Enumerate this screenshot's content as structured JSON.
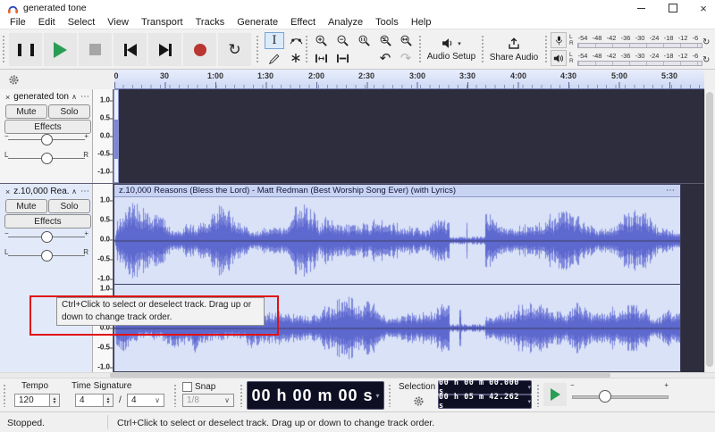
{
  "window": {
    "title": "generated tone"
  },
  "menu": {
    "items": [
      "File",
      "Edit",
      "Select",
      "View",
      "Transport",
      "Tracks",
      "Generate",
      "Effect",
      "Analyze",
      "Tools",
      "Help"
    ]
  },
  "toolbar": {
    "audio_setup": "Audio Setup",
    "share_audio": "Share Audio"
  },
  "meters": {
    "scale": [
      "-54",
      "-48",
      "-42",
      "-36",
      "-30",
      "-24",
      "-18",
      "-12",
      "-6"
    ],
    "left": "L",
    "right": "R"
  },
  "timeline": {
    "ticks": [
      "0",
      "30",
      "1:00",
      "1:30",
      "2:00",
      "2:30",
      "3:00",
      "3:30",
      "4:00",
      "4:30",
      "5:00",
      "5:30"
    ]
  },
  "icons": {
    "window_close": "×",
    "close": "×",
    "chevron_up": "∧",
    "menu_dots": "⋯",
    "caret_down": "▾",
    "select_caret": "∨",
    "undo": "↶",
    "redo": "↷",
    "loop": "↻",
    "reset": "↻",
    "multi_tool": "∗",
    "selection_tool": "I",
    "minus": "−",
    "plus": "+"
  },
  "tracks": [
    {
      "name": "generated tone",
      "mute": "Mute",
      "solo": "Solo",
      "effects": "Effects",
      "gain_min": "−",
      "gain_max": "+",
      "pan_left": "L",
      "pan_right": "R",
      "scale": [
        "1.0",
        "0.5",
        "0.0",
        "-0.5",
        "-1.0"
      ]
    },
    {
      "name": "z.10,000 Rea...",
      "mute": "Mute",
      "solo": "Solo",
      "effects": "Effects",
      "gain_min": "−",
      "gain_max": "+",
      "pan_left": "L",
      "pan_right": "R",
      "clip_title": "z.10,000 Reasons (Bless the Lord) - Matt Redman (Best Worship Song Ever) (with Lyrics)",
      "scale": [
        "1.0",
        "0.5",
        "0.0",
        "-0.5",
        "-1.0"
      ]
    }
  ],
  "tooltip": {
    "text": "Ctrl+Click to select or deselect track. Drag up or down to change track order."
  },
  "bottom": {
    "tempo_label": "Tempo",
    "tempo_value": "120",
    "time_signature_label": "Time Signature",
    "time_signature_upper": "4",
    "time_signature_divider": "/",
    "time_signature_lower": "4",
    "snap_label": "Snap",
    "snap_value": "1/8",
    "time_display": "00 h 00 m 00 s",
    "selection_label": "Selection",
    "selection_start": "00 h 00 m 00.000 s",
    "selection_end": "00 h 05 m 42.262 s",
    "speed_min": "−",
    "speed_max": "+"
  },
  "status": {
    "state": "Stopped.",
    "message": "Ctrl+Click to select or deselect track. Drag up or down to change track order."
  },
  "waveform": {
    "color": "#7c86dc",
    "rms_color": "#5e69cf",
    "zero_line": "#3a3a5e",
    "base_amp": 0.93,
    "quiet": {
      "start": 0.592,
      "end": 0.655,
      "amp": 0.1
    },
    "channels": [
      {
        "seed": 23
      },
      {
        "seed": 57
      }
    ]
  }
}
